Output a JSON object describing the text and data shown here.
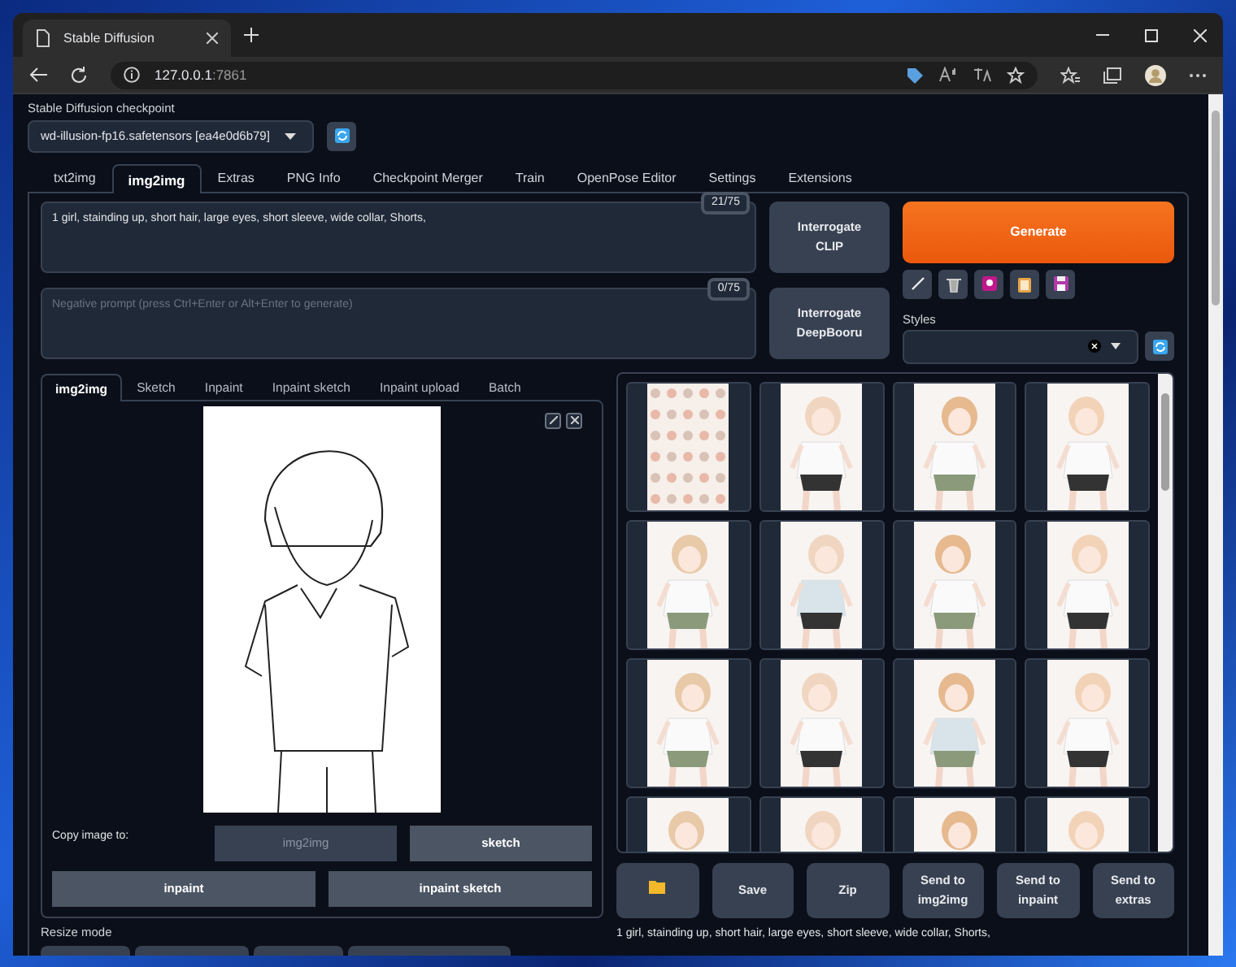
{
  "browser": {
    "tab_title": "Stable Diffusion",
    "url_host": "127.0.0.1",
    "url_port": ":7861"
  },
  "checkpoint": {
    "label": "Stable Diffusion checkpoint",
    "value": "wd-illusion-fp16.safetensors [ea4e0d6b79]"
  },
  "main_tabs": [
    {
      "label": "txt2img",
      "selected": false
    },
    {
      "label": "img2img",
      "selected": true
    },
    {
      "label": "Extras",
      "selected": false
    },
    {
      "label": "PNG Info",
      "selected": false
    },
    {
      "label": "Checkpoint Merger",
      "selected": false
    },
    {
      "label": "Train",
      "selected": false
    },
    {
      "label": "OpenPose Editor",
      "selected": false
    },
    {
      "label": "Settings",
      "selected": false
    },
    {
      "label": "Extensions",
      "selected": false
    }
  ],
  "prompt": {
    "value": "1 girl, stainding up, short hair, large eyes, short sleeve, wide collar, Shorts,",
    "token_count": "21/75"
  },
  "negative_prompt": {
    "placeholder": "Negative prompt (press Ctrl+Enter or Alt+Enter to generate)",
    "token_count": "0/75"
  },
  "interrogate_buttons": [
    "Interrogate CLIP",
    "Interrogate DeepBooru"
  ],
  "generate_button": "Generate",
  "styles": {
    "label": "Styles"
  },
  "image_tabs": [
    {
      "label": "img2img",
      "selected": true
    },
    {
      "label": "Sketch",
      "selected": false
    },
    {
      "label": "Inpaint",
      "selected": false
    },
    {
      "label": "Inpaint sketch",
      "selected": false
    },
    {
      "label": "Inpaint upload",
      "selected": false
    },
    {
      "label": "Batch",
      "selected": false
    }
  ],
  "copy_label": "Copy image to:",
  "copy_buttons": [
    {
      "label": "img2img",
      "disabled": true
    },
    {
      "label": "sketch",
      "disabled": false
    },
    {
      "label": "inpaint",
      "disabled": false
    },
    {
      "label": "inpaint sketch",
      "disabled": false
    }
  ],
  "resize_mode_label": "Resize mode",
  "action_buttons": [
    {
      "kind": "folder"
    },
    {
      "kind": "text",
      "label": "Save"
    },
    {
      "kind": "text",
      "label": "Zip"
    },
    {
      "kind": "text",
      "label": "Send to img2img"
    },
    {
      "kind": "text",
      "label": "Send to inpaint"
    },
    {
      "kind": "text",
      "label": "Send to extras"
    }
  ],
  "caption": "1 girl, stainding up, short hair, large eyes, short sleeve, wide collar, Shorts,"
}
